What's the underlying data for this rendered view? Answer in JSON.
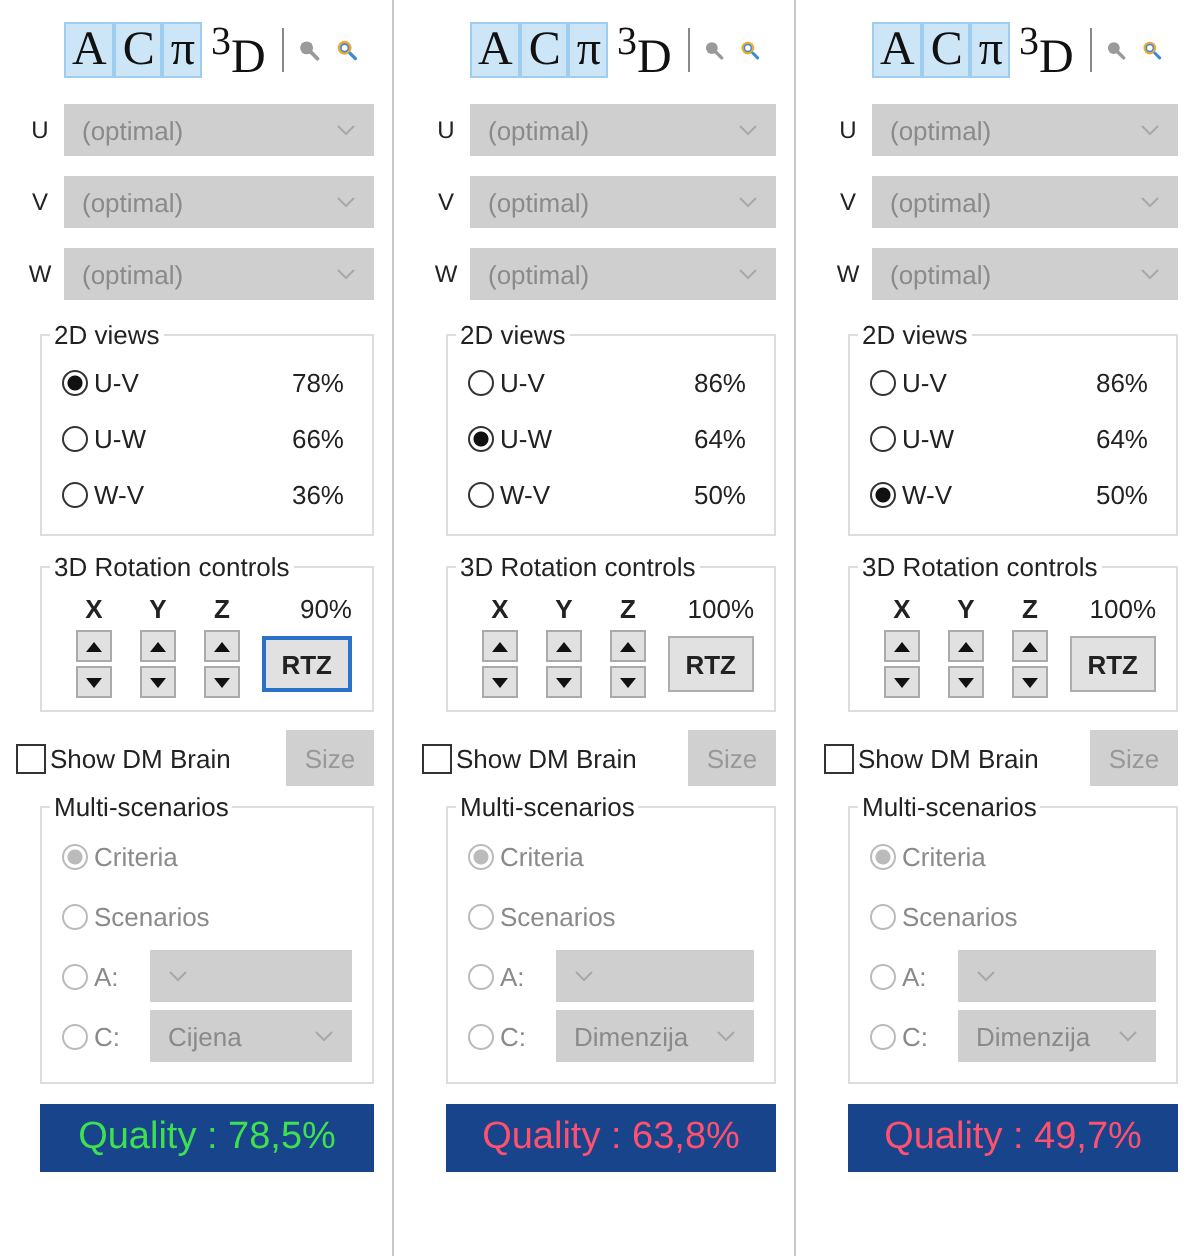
{
  "panels": [
    {
      "tools": [
        {
          "label": "A",
          "selected": true
        },
        {
          "label": "C",
          "selected": true
        },
        {
          "label": "π",
          "selected": true
        },
        {
          "label": "$^{3}$D",
          "selected": false
        }
      ],
      "axes": [
        {
          "label": "U",
          "value": "(optimal)",
          "disabled": true
        },
        {
          "label": "V",
          "value": "(optimal)",
          "disabled": true
        },
        {
          "label": "W",
          "value": "(optimal)",
          "disabled": true
        }
      ],
      "views": {
        "title": "2D views",
        "options": [
          {
            "label": "U-V",
            "percent": "78%",
            "selected": true
          },
          {
            "label": "U-W",
            "percent": "66%",
            "selected": false
          },
          {
            "label": "W-V",
            "percent": "36%",
            "selected": false
          }
        ]
      },
      "rotation": {
        "title": "3D Rotation controls",
        "axes": [
          "X",
          "Y",
          "Z"
        ],
        "percent": "90%",
        "button": {
          "label": "RTZ",
          "focused": true
        }
      },
      "brain": {
        "label": "Show DM Brain",
        "checked": false,
        "button": {
          "label": "Size",
          "disabled": true
        }
      },
      "scenarios": {
        "title": "Multi-scenarios",
        "disabled": true,
        "options": [
          {
            "kind": "radio",
            "label": "Criteria",
            "selected": true
          },
          {
            "kind": "radio",
            "label": "Scenarios",
            "selected": false
          },
          {
            "kind": "combo",
            "label": "A:",
            "selected": false
          },
          {
            "kind": "combo",
            "label": "C:",
            "selected": false,
            "value": "Cijena"
          }
        ]
      },
      "quality": {
        "text": "Quality : 78,5%",
        "color": "#3ee050"
      }
    },
    {
      "tools": [
        {
          "label": "A",
          "selected": true
        },
        {
          "label": "C",
          "selected": true
        },
        {
          "label": "π",
          "selected": true
        },
        {
          "label": "$^{3}$D",
          "selected": false
        }
      ],
      "axes": [
        {
          "label": "U",
          "value": "(optimal)",
          "disabled": true
        },
        {
          "label": "V",
          "value": "(optimal)",
          "disabled": true
        },
        {
          "label": "W",
          "value": "(optimal)",
          "disabled": true
        }
      ],
      "views": {
        "title": "2D views",
        "options": [
          {
            "label": "U-V",
            "percent": "86%",
            "selected": false
          },
          {
            "label": "U-W",
            "percent": "64%",
            "selected": true
          },
          {
            "label": "W-V",
            "percent": "50%",
            "selected": false
          }
        ]
      },
      "rotation": {
        "title": "3D Rotation controls",
        "axes": [
          "X",
          "Y",
          "Z"
        ],
        "percent": "100%",
        "button": {
          "label": "RTZ",
          "focused": false
        }
      },
      "brain": {
        "label": "Show DM Brain",
        "checked": false,
        "button": {
          "label": "Size",
          "disabled": true
        }
      },
      "scenarios": {
        "title": "Multi-scenarios",
        "disabled": true,
        "options": [
          {
            "kind": "radio",
            "label": "Criteria",
            "selected": true
          },
          {
            "kind": "radio",
            "label": "Scenarios",
            "selected": false
          },
          {
            "kind": "combo",
            "label": "A:",
            "selected": false
          },
          {
            "kind": "combo",
            "label": "C:",
            "selected": false,
            "value": "Dimenzija"
          }
        ]
      },
      "quality": {
        "text": "Quality : 63,8%",
        "color": "#ff5070"
      }
    },
    {
      "tools": [
        {
          "label": "A",
          "selected": true
        },
        {
          "label": "C",
          "selected": true
        },
        {
          "label": "π",
          "selected": true
        },
        {
          "label": "$^{3}$D",
          "selected": false
        }
      ],
      "axes": [
        {
          "label": "U",
          "value": "(optimal)",
          "disabled": true
        },
        {
          "label": "V",
          "value": "(optimal)",
          "disabled": true
        },
        {
          "label": "W",
          "value": "(optimal)",
          "disabled": true
        }
      ],
      "views": {
        "title": "2D views",
        "options": [
          {
            "label": "U-V",
            "percent": "86%",
            "selected": false
          },
          {
            "label": "U-W",
            "percent": "64%",
            "selected": false
          },
          {
            "label": "W-V",
            "percent": "50%",
            "selected": true
          }
        ]
      },
      "rotation": {
        "title": "3D Rotation controls",
        "axes": [
          "X",
          "Y",
          "Z"
        ],
        "percent": "100%",
        "button": {
          "label": "RTZ",
          "focused": false
        }
      },
      "brain": {
        "label": "Show DM Brain",
        "checked": false,
        "button": {
          "label": "Size",
          "disabled": true
        }
      },
      "scenarios": {
        "title": "Multi-scenarios",
        "disabled": true,
        "options": [
          {
            "kind": "radio",
            "label": "Criteria",
            "selected": true
          },
          {
            "kind": "radio",
            "label": "Scenarios",
            "selected": false
          },
          {
            "kind": "combo",
            "label": "A:",
            "selected": false
          },
          {
            "kind": "combo",
            "label": "C:",
            "selected": false,
            "value": "Dimenzija"
          }
        ]
      },
      "quality": {
        "text": "Quality : 49,7%",
        "color": "#ff5070"
      }
    }
  ]
}
